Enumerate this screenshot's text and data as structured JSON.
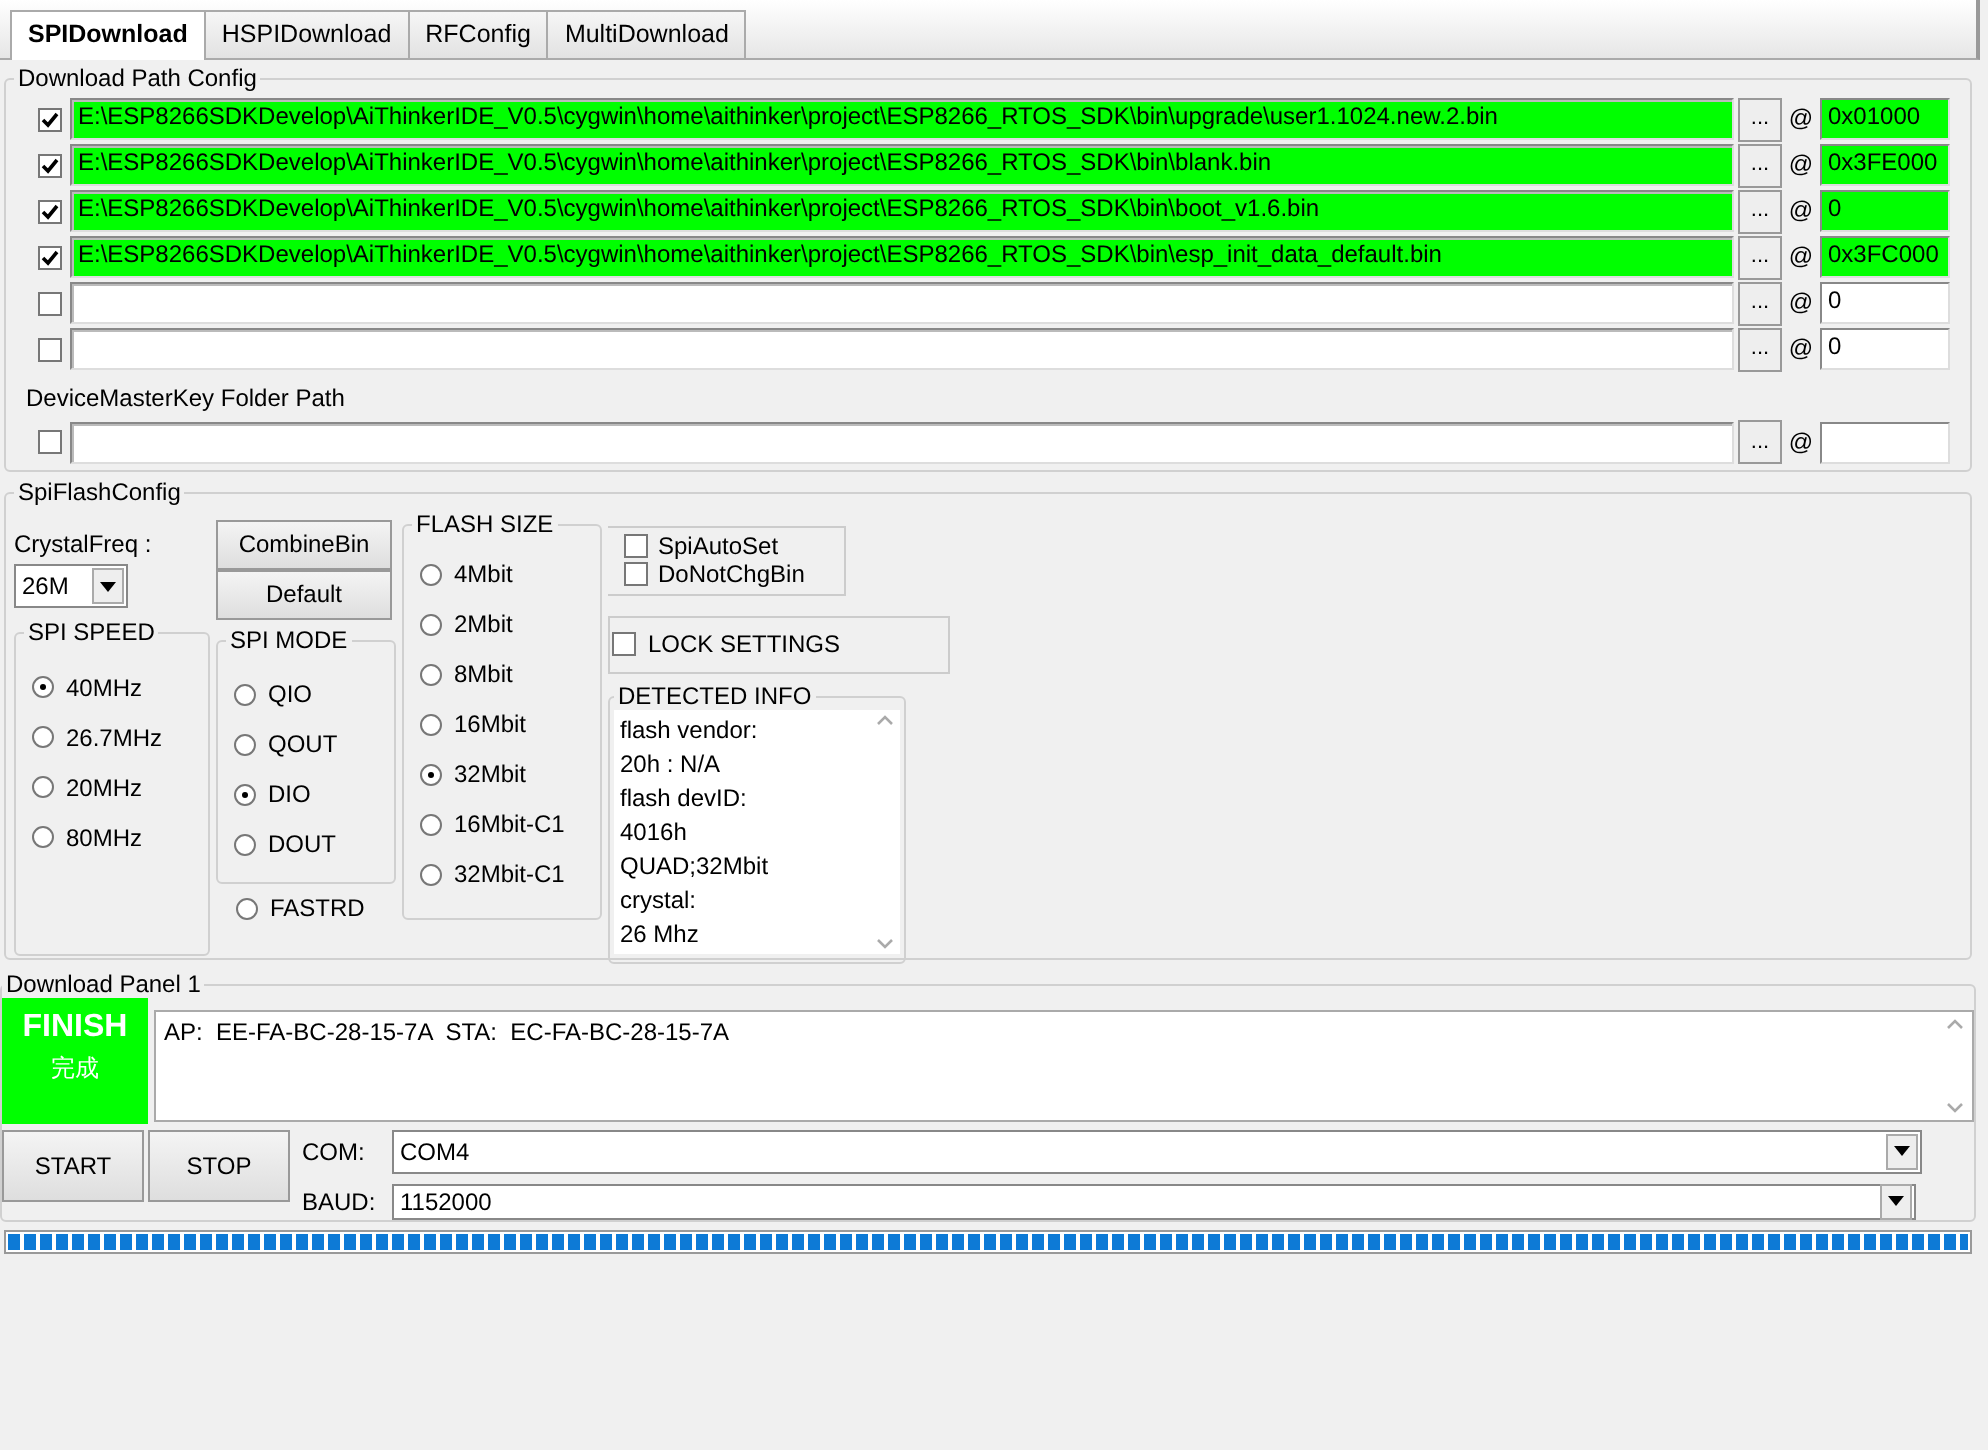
{
  "tabs": [
    {
      "label": "SPIDownload",
      "selected": true
    },
    {
      "label": "HSPIDownload",
      "selected": false
    },
    {
      "label": "RFConfig",
      "selected": false
    },
    {
      "label": "MultiDownload",
      "selected": false
    }
  ],
  "download_path_config": {
    "title": "Download Path Config",
    "rows": [
      {
        "checked": true,
        "path": "E:\\ESP8266SDKDevelop\\AiThinkerIDE_V0.5\\cygwin\\home\\aithinker\\project\\ESP8266_RTOS_SDK\\bin\\upgrade\\user1.1024.new.2.bin",
        "browse": "...",
        "at": "@",
        "address": "0x01000",
        "valid": true
      },
      {
        "checked": true,
        "path": "E:\\ESP8266SDKDevelop\\AiThinkerIDE_V0.5\\cygwin\\home\\aithinker\\project\\ESP8266_RTOS_SDK\\bin\\blank.bin",
        "browse": "...",
        "at": "@",
        "address": "0x3FE000",
        "valid": true
      },
      {
        "checked": true,
        "path": "E:\\ESP8266SDKDevelop\\AiThinkerIDE_V0.5\\cygwin\\home\\aithinker\\project\\ESP8266_RTOS_SDK\\bin\\boot_v1.6.bin",
        "browse": "...",
        "at": "@",
        "address": "0",
        "valid": true
      },
      {
        "checked": true,
        "path": "E:\\ESP8266SDKDevelop\\AiThinkerIDE_V0.5\\cygwin\\home\\aithinker\\project\\ESP8266_RTOS_SDK\\bin\\esp_init_data_default.bin",
        "browse": "...",
        "at": "@",
        "address": "0x3FC000",
        "valid": true
      },
      {
        "checked": false,
        "browse": "...",
        "at": "@",
        "address": "0",
        "valid": false
      },
      {
        "checked": false,
        "browse": "...",
        "at": "@",
        "address": "0",
        "valid": false
      }
    ],
    "master_key": {
      "title": "DeviceMasterKey Folder Path",
      "checked": false,
      "browse": "...",
      "at": "@",
      "valid": false
    }
  },
  "spi_flash_config": {
    "title": "SpiFlashConfig",
    "crystal_freq": {
      "label": "CrystalFreq :",
      "value": "26M"
    },
    "buttons": [
      "CombineBin",
      "Default"
    ],
    "spi_speed": {
      "title": "SPI SPEED",
      "options": [
        {
          "label": "40MHz",
          "selected": true
        },
        {
          "label": "26.7MHz",
          "selected": false
        },
        {
          "label": "20MHz",
          "selected": false
        },
        {
          "label": "80MHz",
          "selected": false
        }
      ]
    },
    "spi_mode": {
      "title": "SPI MODE",
      "options": [
        {
          "label": "QIO",
          "selected": false
        },
        {
          "label": "QOUT",
          "selected": false
        },
        {
          "label": "DIO",
          "selected": true
        },
        {
          "label": "DOUT",
          "selected": false
        },
        {
          "label": "FASTRD",
          "selected": false
        }
      ]
    },
    "flash_size": {
      "title": "FLASH SIZE",
      "options": [
        {
          "label": "4Mbit",
          "selected": false
        },
        {
          "label": "2Mbit",
          "selected": false
        },
        {
          "label": "8Mbit",
          "selected": false
        },
        {
          "label": "16Mbit",
          "selected": false
        },
        {
          "label": "32Mbit",
          "selected": true
        },
        {
          "label": "16Mbit-C1",
          "selected": false
        },
        {
          "label": "32Mbit-C1",
          "selected": false
        }
      ]
    },
    "options": [
      {
        "label": "SpiAutoSet",
        "checked": false
      },
      {
        "label": "DoNotChgBin",
        "checked": false
      }
    ],
    "lock_settings": {
      "label": "LOCK SETTINGS",
      "checked": false
    },
    "detected_info": {
      "title": "DETECTED INFO",
      "lines": [
        "flash vendor:",
        "20h : N/A",
        "flash devID:",
        "4016h",
        "QUAD;32Mbit",
        "crystal:",
        "26 Mhz"
      ]
    }
  },
  "download_panel": {
    "title": "Download Panel 1",
    "status": {
      "kind": "finish",
      "title": "FINISH",
      "subtitle": "完成"
    },
    "log": "AP:  EE-FA-BC-28-15-7A  STA:  EC-FA-BC-28-15-7A",
    "buttons": [
      "START",
      "STOP"
    ],
    "com": {
      "label": "COM:",
      "value": "COM4"
    },
    "baud": {
      "label": "BAUD:",
      "value": "1152000"
    },
    "progress": {
      "level": 1
    }
  }
}
